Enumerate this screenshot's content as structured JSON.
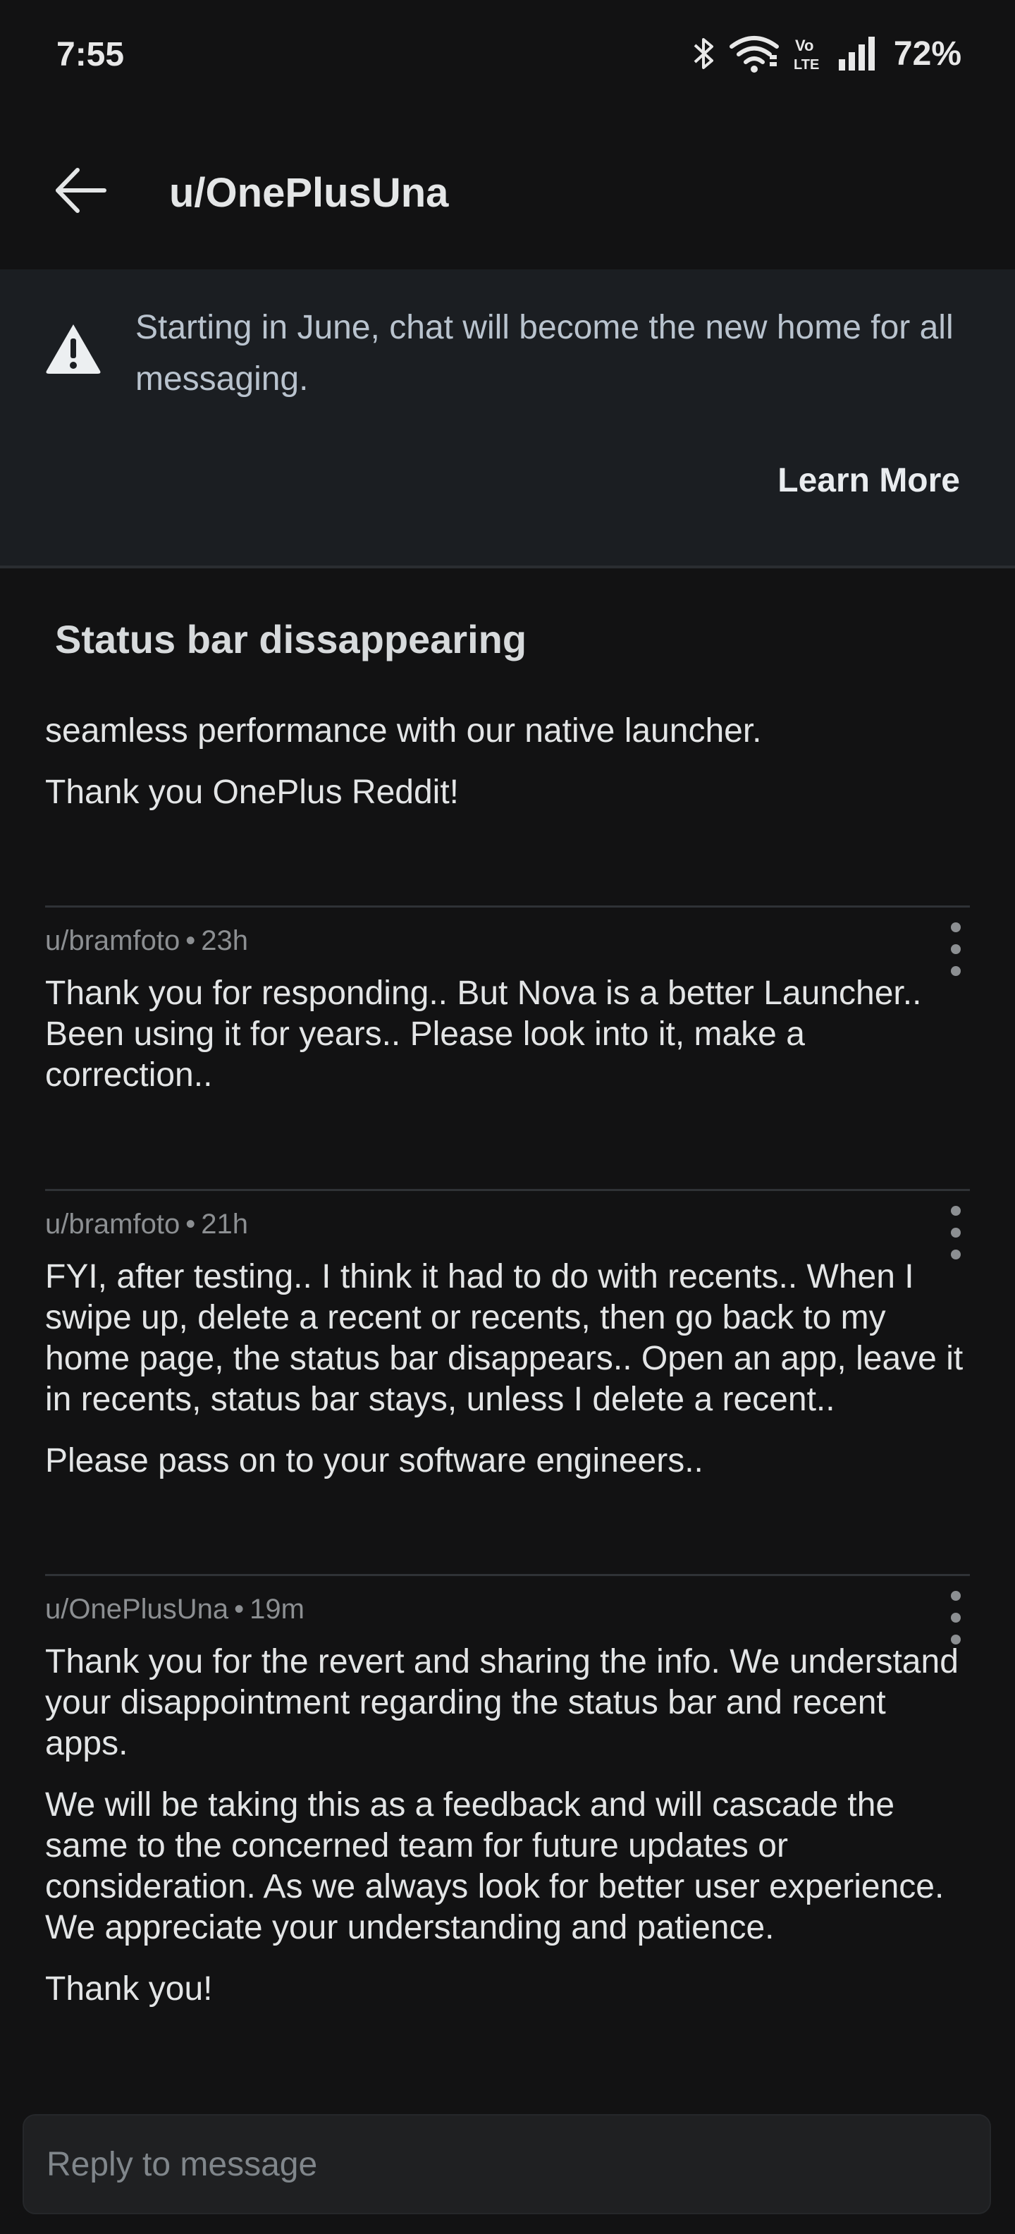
{
  "status_bar": {
    "time": "7:55",
    "battery": "72%",
    "icons": [
      "bluetooth-icon",
      "wifi-icon",
      "volte-icon",
      "signal-icon"
    ],
    "volte_top": "Vo",
    "volte_bottom": "LTE"
  },
  "header": {
    "title": "u/OnePlusUna"
  },
  "banner": {
    "text": "Starting in June, chat will become the new home for all messaging.",
    "action": "Learn More"
  },
  "thread": {
    "subject": "Status bar dissappearing",
    "original_tail": [
      "seamless performance with our native launcher.",
      "Thank you OnePlus Reddit!"
    ],
    "messages": [
      {
        "author": "u/bramfoto",
        "time": "23h",
        "paragraphs": [
          "Thank you for responding.. But Nova is a better Launcher.. Been using it for years.. Please look into it, make a correction.."
        ]
      },
      {
        "author": "u/bramfoto",
        "time": "21h",
        "paragraphs": [
          "FYI, after testing.. I think it had to do with recents.. When I swipe up, delete a recent or recents, then go back to my home page, the status bar disappears.. Open an app, leave it in recents, status bar stays, unless I delete a recent..",
          "Please pass on to your software engineers.."
        ]
      },
      {
        "author": "u/OnePlusUna",
        "time": "19m",
        "paragraphs": [
          "Thank you for the revert and sharing the info. We understand your disappointment regarding the status bar and recent apps.",
          "We will be taking this as a feedback and will cascade the same to the concerned team for future updates or consideration. As we always look for better user experience. We appreciate your understanding and patience.",
          "Thank you!"
        ]
      }
    ]
  },
  "reply": {
    "placeholder": "Reply to message"
  }
}
